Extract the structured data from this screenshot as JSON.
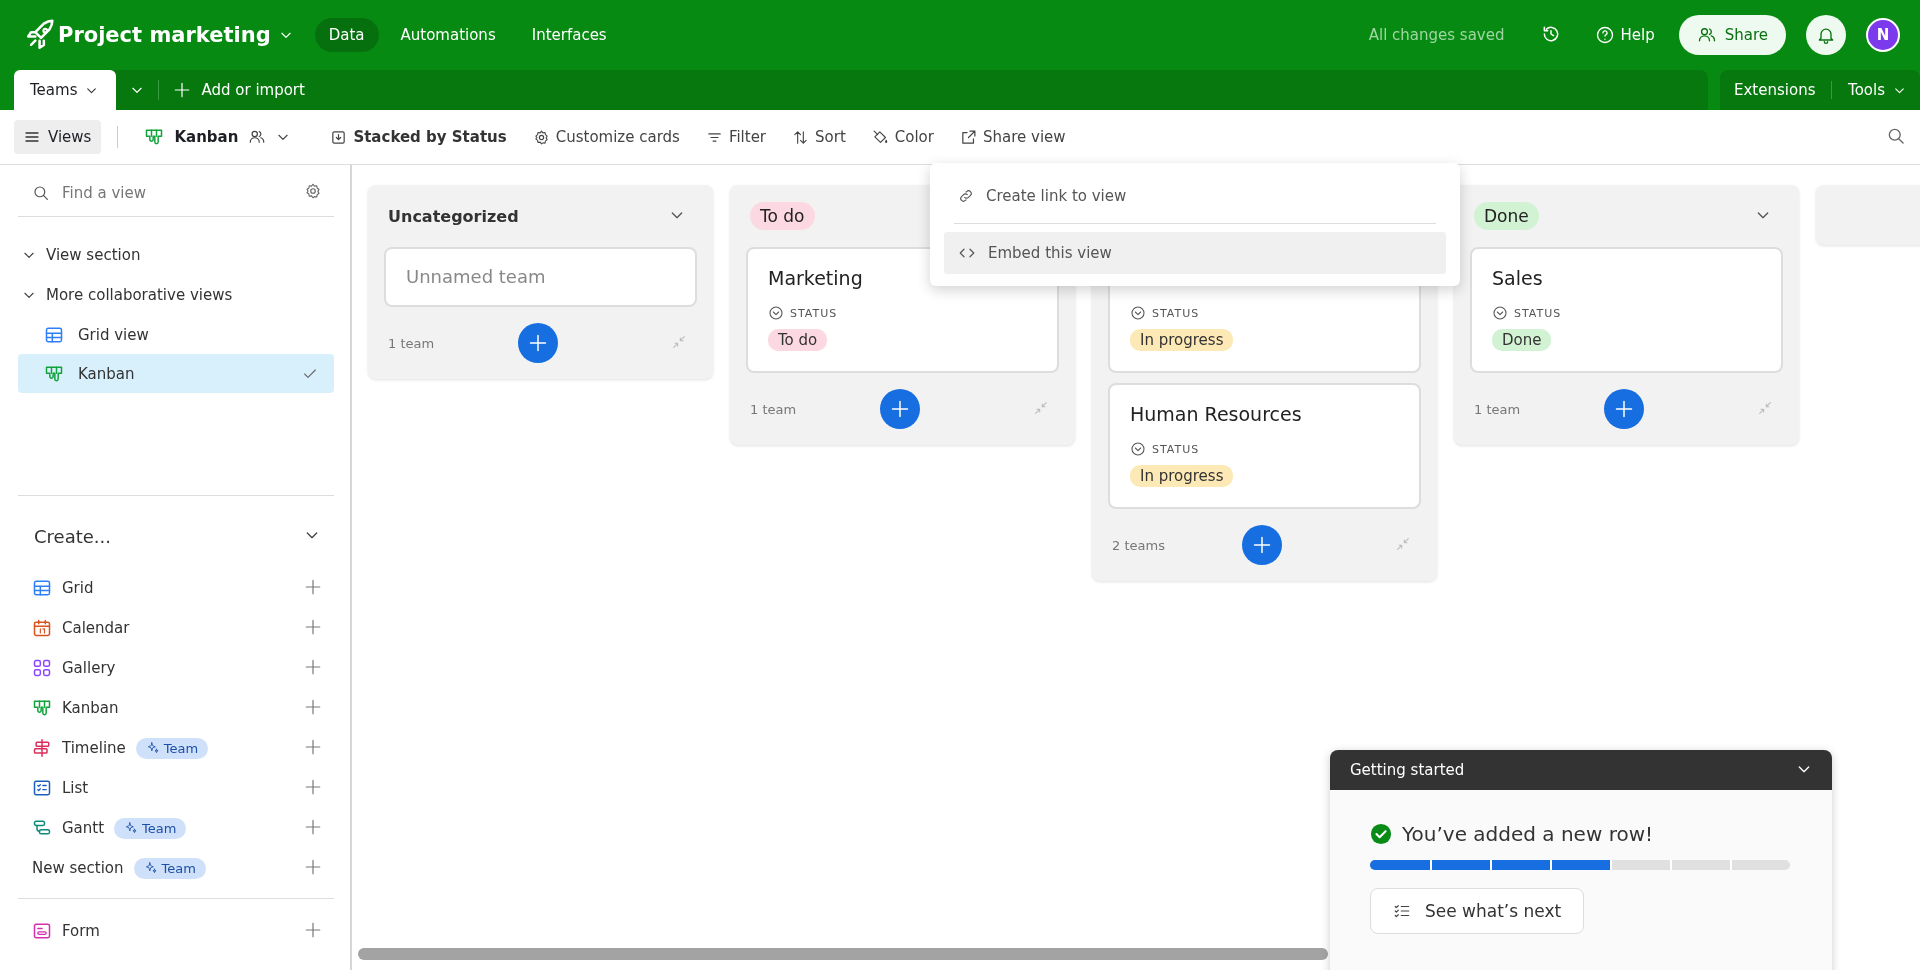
{
  "app_bar": {
    "base_name": "Project marketing",
    "nav": [
      {
        "label": "Data",
        "selected": true
      },
      {
        "label": "Automations",
        "selected": false
      },
      {
        "label": "Interfaces",
        "selected": false
      }
    ],
    "save_status": "All changes saved",
    "help": "Help",
    "share": "Share",
    "avatar": "N"
  },
  "table_tabs": {
    "tabs": [
      {
        "label": "Teams",
        "selected": true
      }
    ],
    "add": "Add or import",
    "extensions": "Extensions",
    "tools": "Tools"
  },
  "view_bar": {
    "views": "Views",
    "view_name": "Kanban",
    "actions": [
      {
        "kind": "stack",
        "label": "Stacked by Status"
      },
      {
        "kind": "customize",
        "label": "Customize cards"
      },
      {
        "kind": "filter",
        "label": "Filter"
      },
      {
        "kind": "sort",
        "label": "Sort"
      },
      {
        "kind": "color",
        "label": "Color"
      },
      {
        "kind": "share",
        "label": "Share view"
      }
    ]
  },
  "sidebar": {
    "search": {
      "placeholder": "Find a view"
    },
    "tree": [
      {
        "label": "View section",
        "expanded": true
      },
      {
        "label": "More collaborative views",
        "expanded": true,
        "children": [
          {
            "kind": "grid",
            "label": "Grid view",
            "selected": false
          },
          {
            "kind": "kanban",
            "label": "Kanban",
            "selected": true
          }
        ]
      }
    ],
    "create": {
      "title": "Create...",
      "items": [
        {
          "kind": "grid",
          "label": "Grid"
        },
        {
          "kind": "calendar",
          "label": "Calendar"
        },
        {
          "kind": "gallery",
          "label": "Gallery"
        },
        {
          "kind": "kanban",
          "label": "Kanban"
        },
        {
          "kind": "timeline",
          "label": "Timeline",
          "badge": "Team"
        },
        {
          "kind": "list",
          "label": "List"
        },
        {
          "kind": "gantt",
          "label": "Gantt",
          "badge": "Team"
        },
        {
          "kind": "section",
          "label": "New section",
          "badge": "Team"
        }
      ],
      "more_items": [
        {
          "kind": "form",
          "label": "Form"
        }
      ]
    }
  },
  "board": {
    "columns": [
      {
        "kind": "plain",
        "label": "Uncategorized",
        "count": "1 team",
        "cards": [
          {
            "placeholder": "Unnamed team"
          }
        ]
      },
      {
        "kind": "status",
        "label": "To do",
        "color": "#fcd9e2",
        "count": "1 team",
        "cards": [
          {
            "title": "Marketing",
            "field": "STATUS",
            "status": "To do",
            "color": "#fcd9e2"
          }
        ]
      },
      {
        "kind": "status",
        "count": "2 teams",
        "cards": [
          {
            "field": "STATUS",
            "status": "In progress",
            "color": "#fde9b5"
          },
          {
            "title": "Human Resources",
            "field": "STATUS",
            "status": "In progress",
            "color": "#fde9b5"
          }
        ]
      },
      {
        "kind": "status",
        "label": "Done",
        "color": "#d1f2d3",
        "count": "1 team",
        "cards": [
          {
            "title": "Sales",
            "field": "STATUS",
            "status": "Done",
            "color": "#d1f2d3"
          }
        ]
      },
      {
        "kind": "stub"
      }
    ]
  },
  "menu": {
    "items": [
      {
        "kind": "link",
        "label": "Create link to view",
        "selected": false
      },
      {
        "kind": "embed",
        "label": "Embed this view",
        "selected": true
      }
    ]
  },
  "getting_started": {
    "title": "Getting started",
    "message": "You’ve added a new row!",
    "progress": {
      "level": 0.5714
    },
    "button": "See what’s next"
  }
}
